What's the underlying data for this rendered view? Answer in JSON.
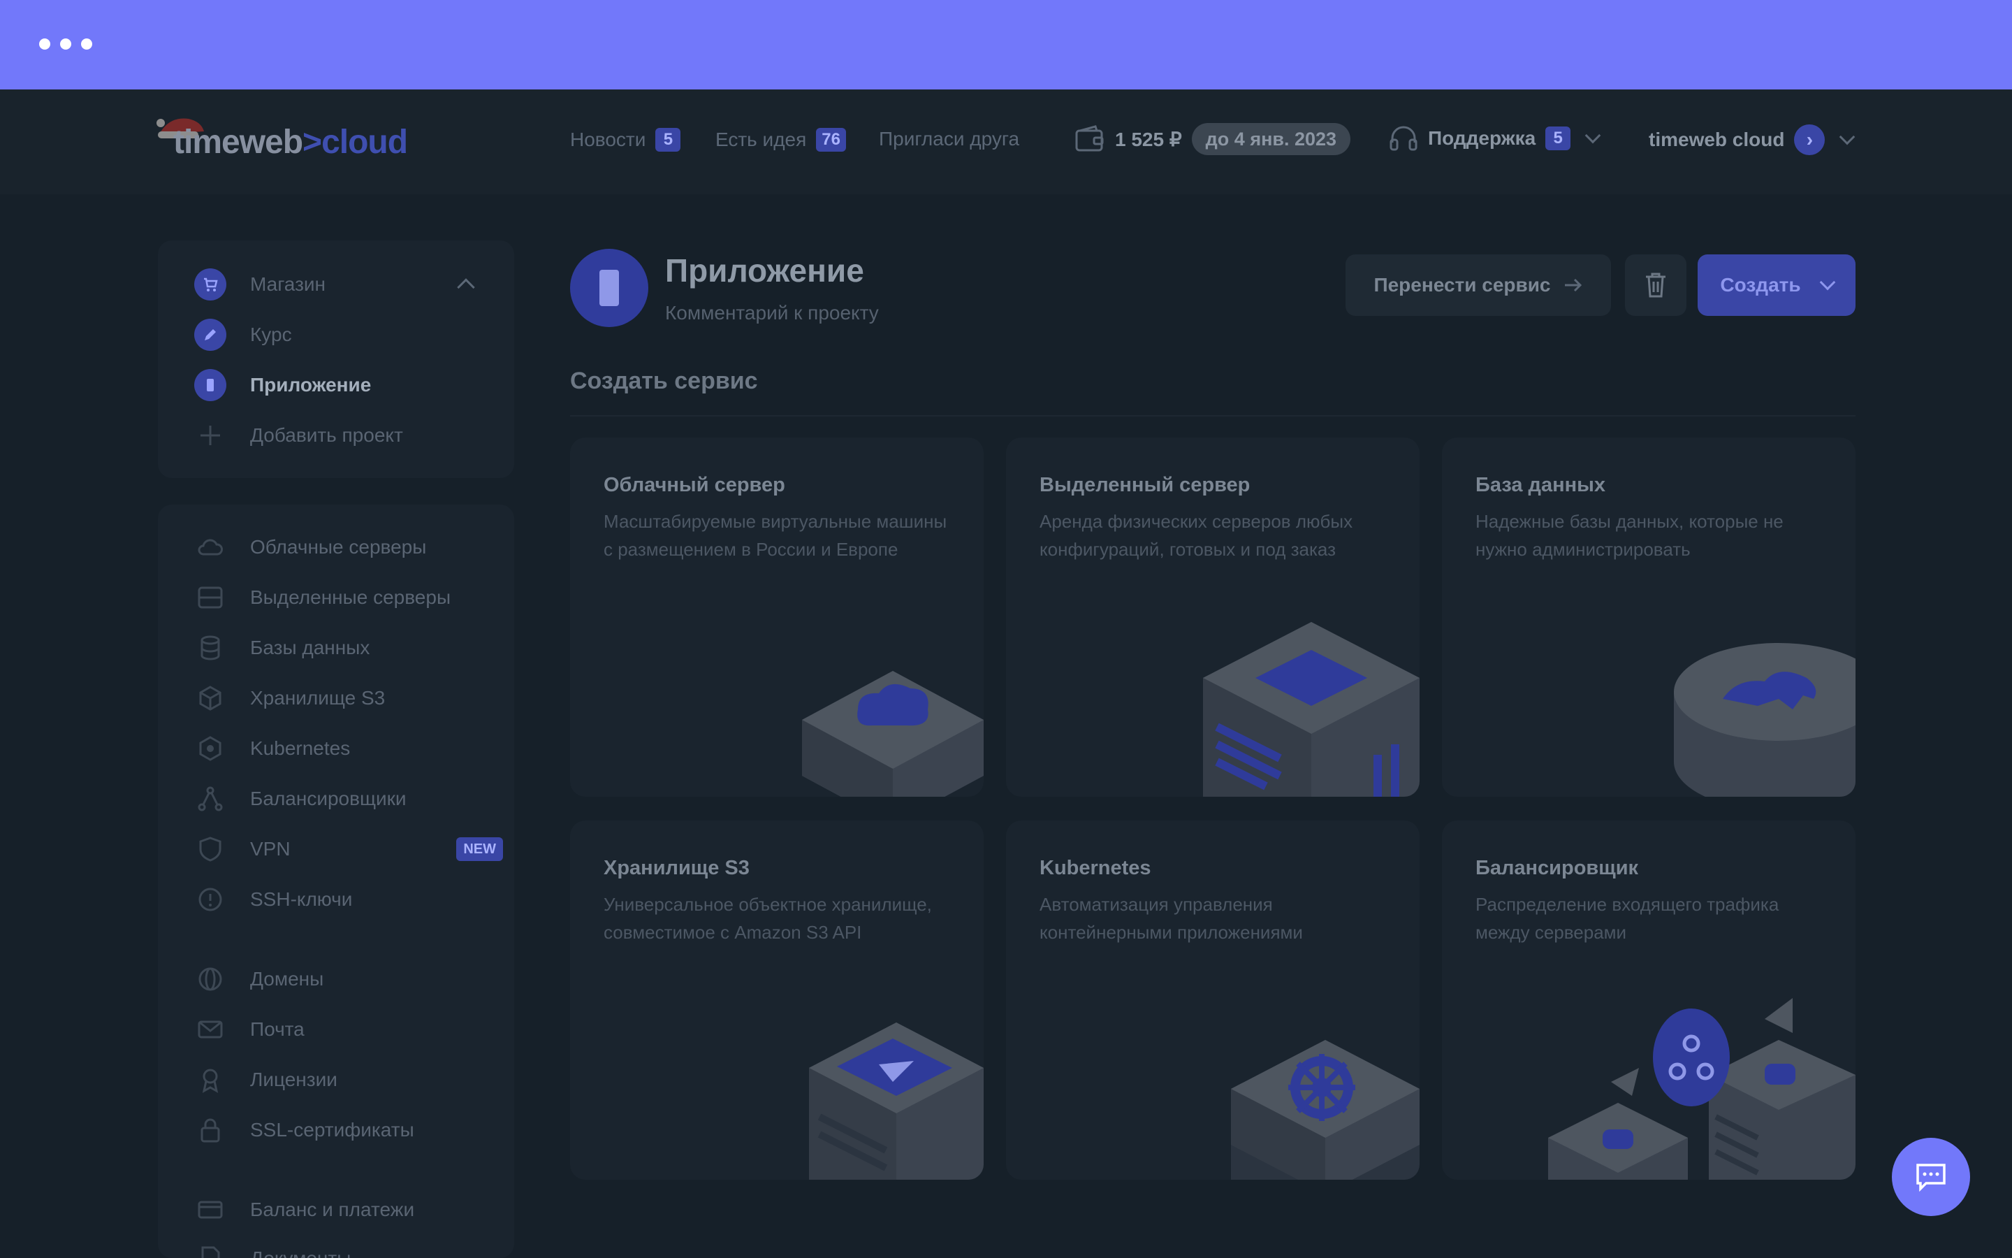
{
  "header": {
    "logo_main": "timeweb",
    "logo_sep": ">",
    "logo_accent": "cloud",
    "news_label": "Новости",
    "news_count": "5",
    "idea_label": "Есть идея",
    "idea_count": "76",
    "invite_label": "Пригласи друга",
    "balance": "1 525 ₽",
    "balance_until": "до 4 янв. 2023",
    "support_label": "Поддержка",
    "support_count": "5",
    "account_name": "timeweb cloud"
  },
  "sidebar": {
    "projects": [
      {
        "label": "Магазин",
        "icon": "cart-icon"
      },
      {
        "label": "Курс",
        "icon": "pencil-icon"
      },
      {
        "label": "Приложение",
        "icon": "phone-icon"
      },
      {
        "label": "Добавить проект",
        "icon": "plus-icon"
      }
    ],
    "services": [
      {
        "label": "Облачные серверы",
        "icon": "cloud-icon"
      },
      {
        "label": "Выделенные серверы",
        "icon": "server-icon"
      },
      {
        "label": "Базы данных",
        "icon": "database-icon"
      },
      {
        "label": "Хранилище S3",
        "icon": "cube-icon"
      },
      {
        "label": "Kubernetes",
        "icon": "kubernetes-icon"
      },
      {
        "label": "Балансировщики",
        "icon": "balancer-icon"
      },
      {
        "label": "VPN",
        "icon": "shield-icon",
        "badge": "NEW"
      },
      {
        "label": "SSH-ключи",
        "icon": "key-icon"
      },
      {
        "label": "Домены",
        "icon": "globe-icon"
      },
      {
        "label": "Почта",
        "icon": "mail-icon"
      },
      {
        "label": "Лицензии",
        "icon": "license-icon"
      },
      {
        "label": "SSL-сертификаты",
        "icon": "lock-icon"
      },
      {
        "label": "Баланс и платежи",
        "icon": "card-icon"
      },
      {
        "label": "Документы",
        "icon": "document-icon"
      }
    ]
  },
  "main": {
    "title": "Приложение",
    "subtitle": "Комментарий к проекту",
    "transfer_button": "Перенести сервис",
    "create_button": "Создать",
    "section_title": "Создать сервис",
    "cards": [
      {
        "title": "Облачный сервер",
        "desc": "Масштабируемые виртуальные машины с размещением в России и Европе",
        "art": "cloud-server-illustration"
      },
      {
        "title": "Выделенный сервер",
        "desc": "Аренда физических серверов любых конфигураций, готовых и под заказ",
        "art": "dedicated-server-illustration"
      },
      {
        "title": "База данных",
        "desc": "Надежные базы данных, которые не нужно администрировать",
        "art": "database-illustration"
      },
      {
        "title": "Хранилище S3",
        "desc": "Универсальное объектное хранилище, совместимое с Amazon S3 API",
        "art": "s3-storage-illustration"
      },
      {
        "title": "Kubernetes",
        "desc": "Автоматизация управления контейнерными приложениями",
        "art": "kubernetes-illustration"
      },
      {
        "title": "Балансировщик",
        "desc": "Распределение входящего трафика между серверами",
        "art": "balancer-illustration"
      }
    ]
  },
  "colors": {
    "accent": "#7278fa",
    "brand_dim": "#3a46a6",
    "background": "#162029"
  }
}
